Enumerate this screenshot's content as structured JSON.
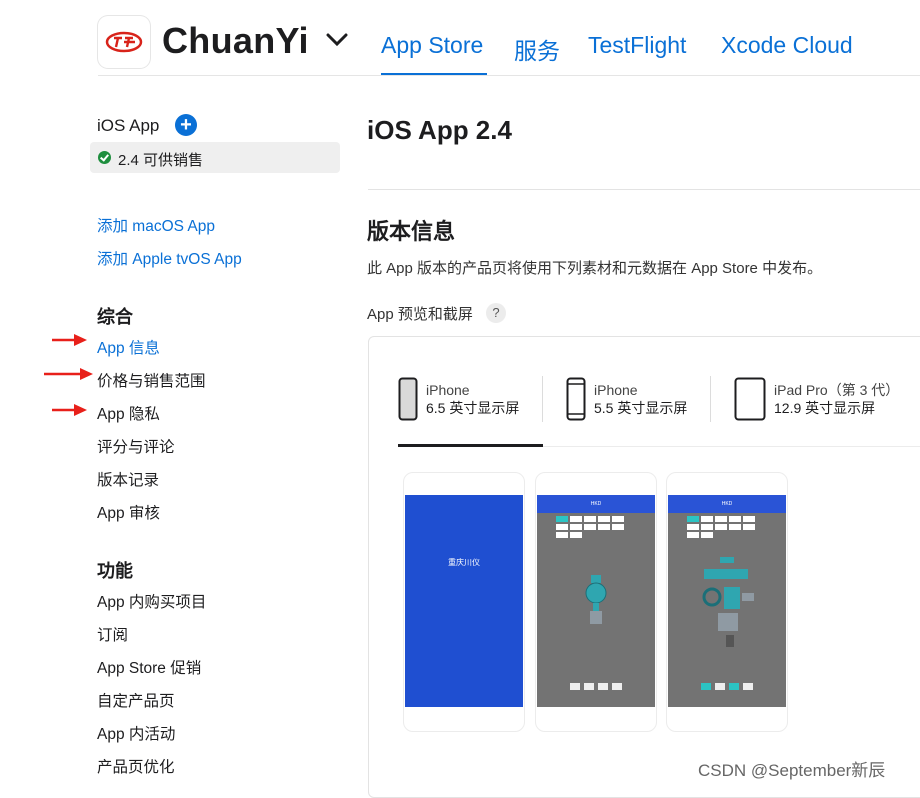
{
  "header": {
    "brand": "ChuanYi",
    "tabs": [
      {
        "label": "App Store",
        "active": true
      },
      {
        "label": "服务"
      },
      {
        "label": "TestFlight"
      },
      {
        "label": "Xcode Cloud"
      }
    ]
  },
  "sidebar": {
    "app_title": "iOS App",
    "version_status": "2.4 可供销售",
    "add_links": [
      "添加 macOS App",
      "添加 Apple tvOS App"
    ],
    "sections": [
      {
        "heading": "综合",
        "items": [
          "App 信息",
          "价格与销售范围",
          "App 隐私",
          "评分与评论",
          "版本记录",
          "App 审核"
        ]
      },
      {
        "heading": "功能",
        "items": [
          "App 内购买项目",
          "订阅",
          "App Store 促销",
          "自定产品页",
          "App 内活动",
          "产品页优化"
        ]
      }
    ]
  },
  "main": {
    "title": "iOS App 2.4",
    "section_title": "版本信息",
    "section_desc": "此 App 版本的产品页将使用下列素材和元数据在 App Store 中发布。",
    "preview_label": "App 预览和截屏",
    "help": "?",
    "device_tabs": [
      {
        "name": "iPhone",
        "size": "6.5 英寸显示屏"
      },
      {
        "name": "iPhone",
        "size": "5.5 英寸显示屏"
      },
      {
        "name": "iPad Pro（第 3 代）",
        "size": "12.9 英寸显示屏"
      }
    ],
    "screenshot_1_text": "重庆川仪",
    "screenshot_header": "HKD"
  },
  "watermark": "CSDN @September新辰",
  "colors": {
    "accent": "#0a70d6",
    "success": "#1e8e3e",
    "arrow": "#e8201a"
  }
}
